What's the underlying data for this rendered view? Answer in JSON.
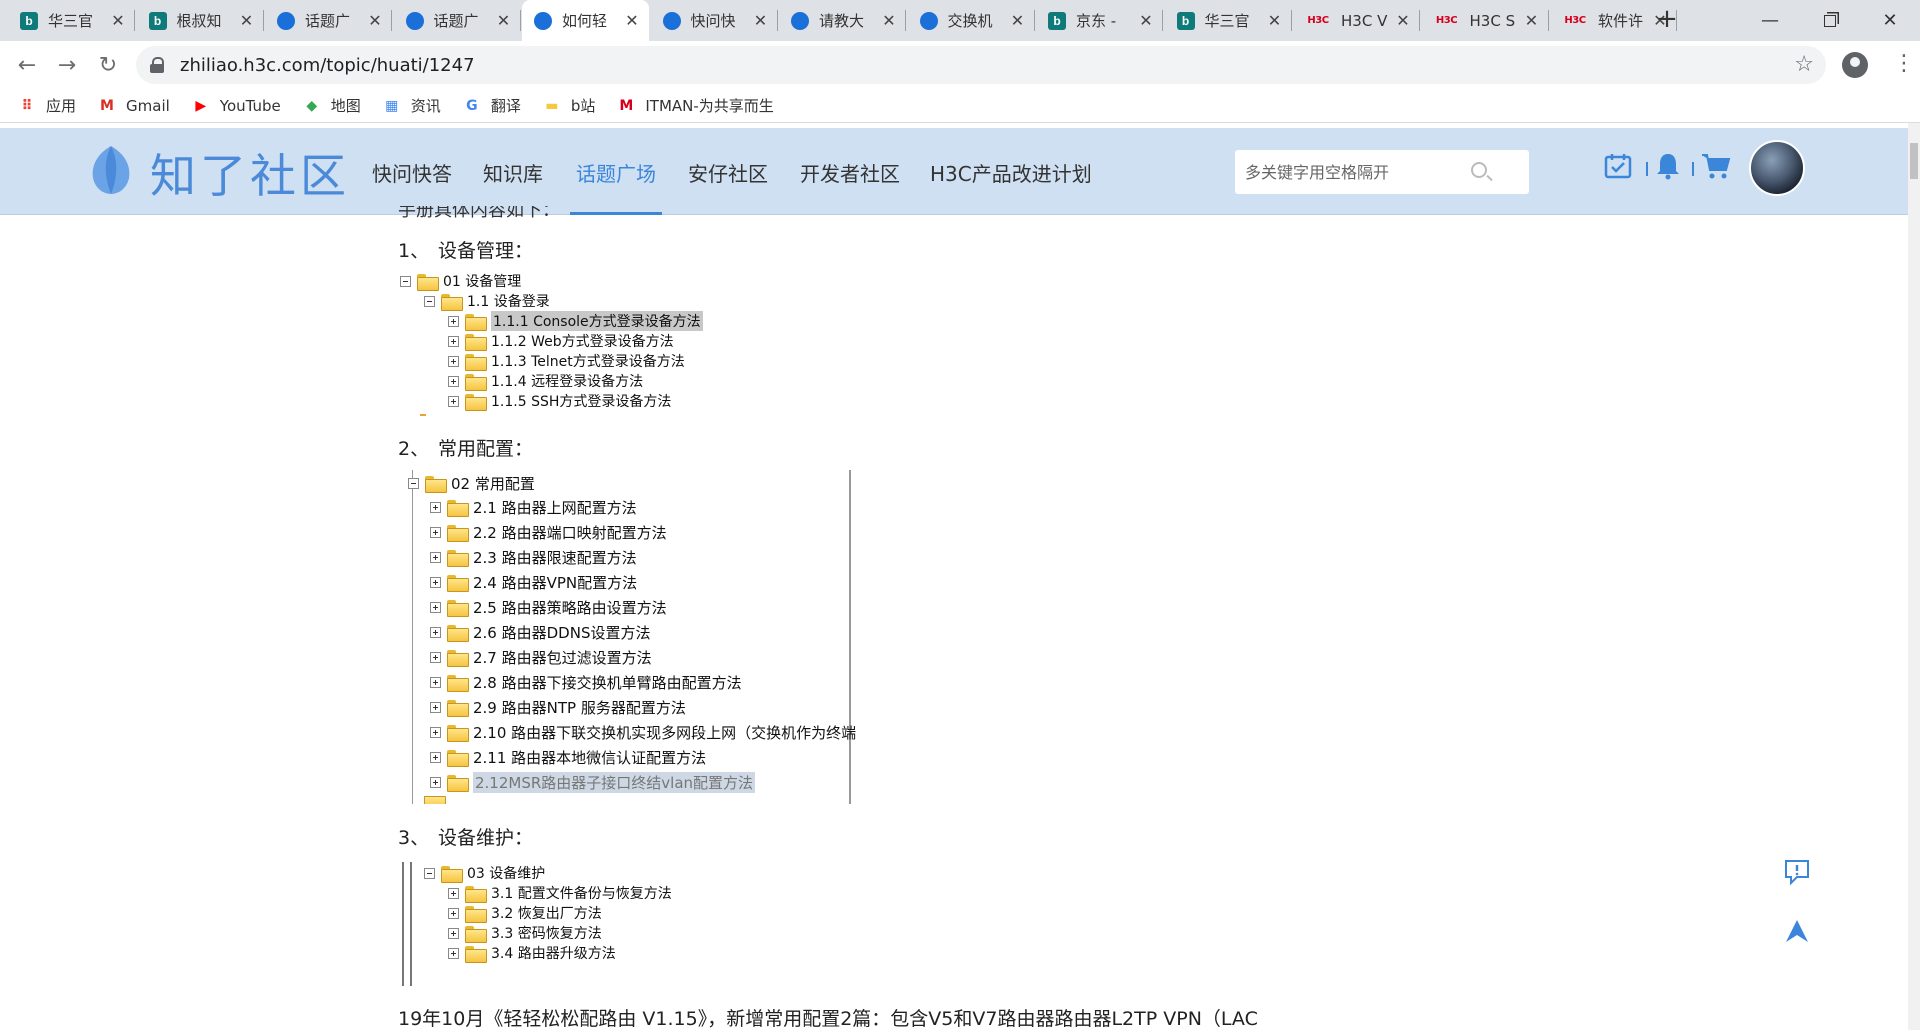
{
  "browser": {
    "tabs": [
      {
        "title": "华三官",
        "favicon": "bing"
      },
      {
        "title": "根叔知",
        "favicon": "bing"
      },
      {
        "title": "话题广",
        "favicon": "zhiliao"
      },
      {
        "title": "话题广",
        "favicon": "zhiliao"
      },
      {
        "title": "如何轻",
        "favicon": "zhiliao",
        "active": true
      },
      {
        "title": "快问快",
        "favicon": "zhiliao"
      },
      {
        "title": "请教大",
        "favicon": "zhiliao"
      },
      {
        "title": "交换机",
        "favicon": "zhiliao"
      },
      {
        "title": "京东 -",
        "favicon": "bing"
      },
      {
        "title": "华三官",
        "favicon": "bing"
      },
      {
        "title": "H3C V",
        "favicon": "h3c"
      },
      {
        "title": "H3C S",
        "favicon": "h3c"
      },
      {
        "title": "软件许",
        "favicon": "h3c"
      }
    ],
    "url": "zhiliao.h3c.com/topic/huati/1247",
    "bookmarks": [
      {
        "label": "应用",
        "icon": "apps-grid-icon"
      },
      {
        "label": "Gmail",
        "icon": "gmail-icon"
      },
      {
        "label": "YouTube",
        "icon": "youtube-icon"
      },
      {
        "label": "地图",
        "icon": "maps-icon"
      },
      {
        "label": "资讯",
        "icon": "news-icon"
      },
      {
        "label": "翻译",
        "icon": "translate-icon"
      },
      {
        "label": "b站",
        "icon": "folder-icon"
      },
      {
        "label": "ITMAN-为共享而生",
        "icon": "itman-icon"
      }
    ]
  },
  "site": {
    "logo_text": "知了社区",
    "nav": [
      "快问快答",
      "知识库",
      "话题广场",
      "安仔社区",
      "开发者社区",
      "H3C产品改进计划"
    ],
    "active_nav": "话题广场",
    "search_placeholder": "多关键字用空格隔开",
    "accent": "#3b86d9",
    "header_bg": "#cfe0f3"
  },
  "article": {
    "cut_line": "手册具体内容如下：",
    "sections": [
      {
        "num": "1、",
        "title": "设备管理："
      },
      {
        "num": "2、",
        "title": "常用配置："
      },
      {
        "num": "3、",
        "title": "设备维护："
      }
    ],
    "tree1": {
      "root": "01 设备管理",
      "sub": "1.1 设备登录",
      "items": [
        "1.1.1 Console方式登录设备方法",
        "1.1.2 Web方式登录设备方法",
        "1.1.3 Telnet方式登录设备方法",
        "1.1.4 远程登录设备方法",
        "1.1.5 SSH方式登录设备方法"
      ]
    },
    "tree2": {
      "root": "02 常用配置",
      "items": [
        "2.1 路由器上网配置方法",
        "2.2 路由器端口映射配置方法",
        "2.3 路由器限速配置方法",
        "2.4 路由器VPN配置方法",
        "2.5 路由器策略路由设置方法",
        "2.6 路由器DDNS设置方法",
        "2.7 路由器包过滤设置方法",
        "2.8 路由器下接交换机单臂路由配置方法",
        "2.9 路由器NTP 服务器配置方法",
        "2.10 路由器下联交换机实现多网段上网（交换机作为终端",
        "2.11 路由器本地微信认证配置方法",
        "2.12MSR路由器子接口终结vlan配置方法"
      ]
    },
    "tree3": {
      "root": "03 设备维护",
      "items": [
        "3.1 配置文件备份与恢复方法",
        "3.2 恢复出厂方法",
        "3.3 密码恢复方法",
        "3.4 路由器升级方法"
      ]
    },
    "bottom_text": "19年10月《轻轻松松配路由 V1.15》，新增常用配置2篇：包含V5和V7路由器路由器L2TP VPN（LAC"
  }
}
